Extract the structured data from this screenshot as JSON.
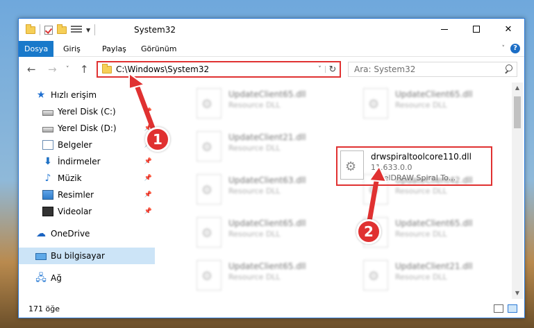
{
  "window": {
    "title": "System32",
    "status_text": "171 öğe"
  },
  "ribbon": {
    "tabs": [
      {
        "label": "Dosya",
        "active": true
      },
      {
        "label": "Giriş"
      },
      {
        "label": "Paylaş"
      },
      {
        "label": "Görünüm"
      }
    ]
  },
  "address": {
    "path": "C:\\Windows\\System32"
  },
  "search": {
    "placeholder": "Ara: System32"
  },
  "sidebar": {
    "items": [
      {
        "label": "Hızlı erişim",
        "icon": "star-icon"
      },
      {
        "label": "Yerel Disk (C:)",
        "icon": "drive-icon",
        "pinned": true
      },
      {
        "label": "Yerel Disk (D:)",
        "icon": "drive-icon",
        "pinned": true
      },
      {
        "label": "Belgeler",
        "icon": "documents-icon",
        "pinned": true
      },
      {
        "label": "İndirmeler",
        "icon": "download-icon",
        "pinned": true
      },
      {
        "label": "Müzik",
        "icon": "music-icon",
        "pinned": true
      },
      {
        "label": "Resimler",
        "icon": "pictures-icon",
        "pinned": true
      },
      {
        "label": "Videolar",
        "icon": "videos-icon",
        "pinned": true
      },
      {
        "label": "OneDrive",
        "icon": "cloud-icon"
      },
      {
        "label": "Bu bilgisayar",
        "icon": "computer-icon",
        "selected": true
      },
      {
        "label": "Ağ",
        "icon": "network-icon"
      }
    ]
  },
  "files": [
    {
      "name": "UpdateClient65.dll",
      "type": "Resource DLL"
    },
    {
      "name": "UpdateClient65.dll",
      "type": "Resource DLL"
    },
    {
      "name": "UpdateClient21.dll",
      "type": "Resource DLL"
    },
    {
      "name": "UpdateClient63.dll",
      "type": "Resource DLL"
    },
    {
      "name": "UpdateClient42.dll",
      "type": "Resource DLL"
    },
    {
      "name": "UpdateClient65.dll",
      "type": "Resource DLL"
    },
    {
      "name": "UpdateClient65.dll",
      "type": "Resource DLL"
    },
    {
      "name": "UpdateClient65.dll",
      "type": "Resource DLL"
    },
    {
      "name": "UpdateClient21.dll",
      "type": "Resource DLL"
    }
  ],
  "highlighted_file": {
    "name": "drwspiraltoolcore110.dll",
    "version": "11.633.0.0",
    "description": "CorelDRAW Spiral To..."
  },
  "annotations": {
    "step1": "1",
    "step2": "2",
    "color": "#e03131"
  }
}
